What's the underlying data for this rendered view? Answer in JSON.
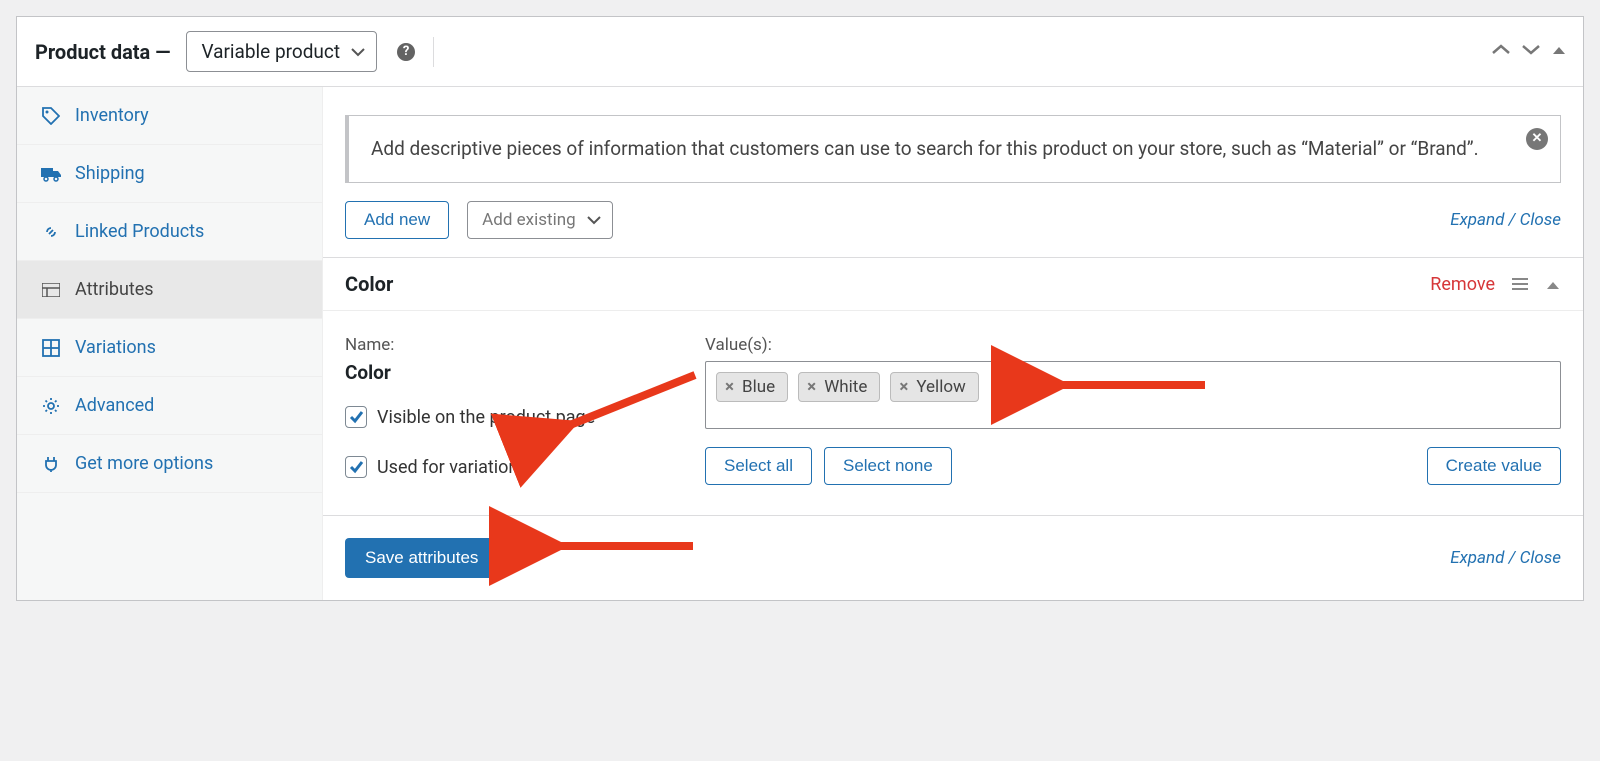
{
  "panel": {
    "title": "Product data —",
    "product_type": "Variable product",
    "up_down_tri": {
      "up": "︿",
      "down": "﹀"
    }
  },
  "tabs": {
    "inventory": "Inventory",
    "shipping": "Shipping",
    "linked": "Linked Products",
    "attributes": "Attributes",
    "variations": "Variations",
    "advanced": "Advanced",
    "more": "Get more options"
  },
  "info": {
    "text": "Add descriptive pieces of information that customers can use to search for this product on your store, such as “Material” or “Brand”."
  },
  "toolbar": {
    "add_new": "Add new",
    "add_existing": "Add existing",
    "expand": "Expand",
    "close": "Close"
  },
  "attribute": {
    "title": "Color",
    "remove": "Remove",
    "name_label": "Name:",
    "name_value": "Color",
    "values_label": "Value(s):",
    "values": [
      "Blue",
      "White",
      "Yellow"
    ],
    "visible_label": "Visible on the product page",
    "used_label": "Used for variations",
    "visible_checked": true,
    "used_checked": true,
    "select_all": "Select all",
    "select_none": "Select none",
    "create_value": "Create value"
  },
  "footer": {
    "save": "Save attributes",
    "expand": "Expand",
    "close": "Close"
  }
}
